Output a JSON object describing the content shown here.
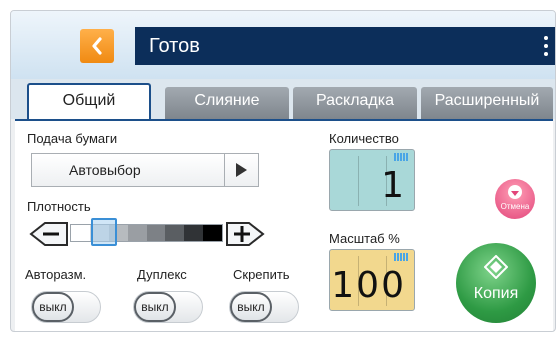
{
  "header": {
    "back_icon": "chevron-left-icon",
    "status_title": "Готов",
    "menu_icon": "kebab-menu-icon"
  },
  "tabs": [
    {
      "label": "Общий",
      "active": true
    },
    {
      "label": "Слияние",
      "active": false
    },
    {
      "label": "Раскладка",
      "active": false
    },
    {
      "label": "Расширенный",
      "active": false
    }
  ],
  "paper_feed": {
    "label": "Подача бумаги",
    "value": "Автовыбор"
  },
  "density": {
    "label": "Плотность",
    "level_fraction": 0.2
  },
  "toggles": [
    {
      "label": "Авторазм.",
      "state": "выкл"
    },
    {
      "label": "Дуплекс",
      "state": "выкл"
    },
    {
      "label": "Скрепить",
      "state": "выкл"
    }
  ],
  "quantity": {
    "label": "Количество",
    "value": "1"
  },
  "scale": {
    "label": "Масштаб %",
    "value": "100"
  },
  "cancel_button": {
    "label": "Отмена"
  },
  "copy_button": {
    "label": "Копия"
  },
  "colors": {
    "title_bar": "#0c2e5a",
    "back_button": "#f08a12",
    "tab_active_border": "#1c4f8a",
    "quantity_bg": "#a9d8d8",
    "scale_bg": "#f2d88e",
    "cancel": "#e2457a",
    "copy": "#2e9a44"
  }
}
